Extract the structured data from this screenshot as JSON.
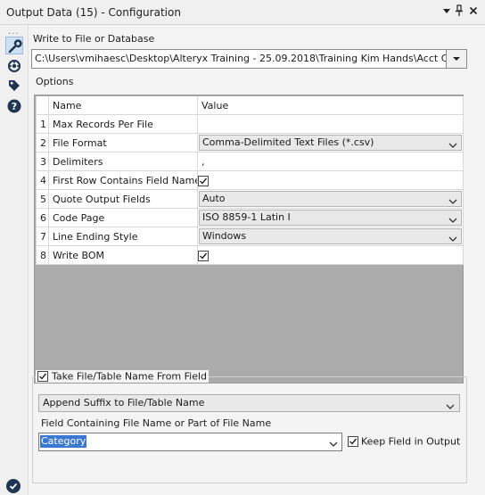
{
  "window": {
    "title": "Output Data (15) - Configuration",
    "controls": {
      "dropdown": "▾",
      "pin": "📌",
      "close": "✕"
    }
  },
  "sidebar": {
    "dots": "...",
    "items": [
      {
        "icon": "wrench-icon",
        "active": true
      },
      {
        "icon": "connector-icon",
        "active": false
      },
      {
        "icon": "tag-icon",
        "active": false
      },
      {
        "icon": "help-icon",
        "active": false
      }
    ]
  },
  "write_to": {
    "label": "Write to File or Database",
    "path": "C:\\Users\\vmihaesc\\Desktop\\Alteryx Training - 25.09.2018\\Training Kim Hands\\Acct Cat Sper"
  },
  "options": {
    "label": "Options",
    "headers": {
      "name": "Name",
      "value": "Value"
    },
    "rows": [
      {
        "num": "1",
        "name": "Max Records Per File",
        "type": "text",
        "value": ""
      },
      {
        "num": "2",
        "name": "File Format",
        "type": "combo",
        "value": "Comma-Delimited Text Files (*.csv)"
      },
      {
        "num": "3",
        "name": "Delimiters",
        "type": "text",
        "value": ","
      },
      {
        "num": "4",
        "name": "First Row Contains Field Names",
        "type": "check",
        "value": "true"
      },
      {
        "num": "5",
        "name": "Quote Output Fields",
        "type": "combo",
        "value": "Auto"
      },
      {
        "num": "6",
        "name": "Code Page",
        "type": "combo",
        "value": "ISO 8859-1 Latin I"
      },
      {
        "num": "7",
        "name": "Line Ending Style",
        "type": "combo",
        "value": "Windows"
      },
      {
        "num": "8",
        "name": "Write BOM",
        "type": "check",
        "value": "true"
      }
    ]
  },
  "take_from_field": {
    "label": "Take File/Table Name From Field",
    "checked": true,
    "mode": "Append Suffix to File/Table Name",
    "field_label": "Field Containing File Name or Part of File Name",
    "field_value": "Category",
    "keep_field_label": "Keep Field in Output",
    "keep_field_checked": true
  },
  "colors": {
    "accent": "#3b78d1",
    "panel": "#f4f4f4"
  }
}
